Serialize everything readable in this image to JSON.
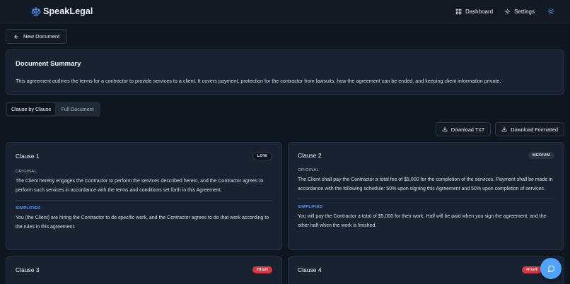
{
  "brand": {
    "name": "SpeakLegal"
  },
  "nav": {
    "dashboard": "Dashboard",
    "settings": "Settings"
  },
  "new_document": "New Document",
  "summary": {
    "title": "Document Summary",
    "text": "This agreement outlines the terms for a contractor to provide services to a client. It covers payment, protection for the contractor from lawsuits, how the agreement can be ended, and keeping client information private."
  },
  "view_toggle": {
    "clause_by_clause": "Clause by Clause",
    "full_document": "Full Document",
    "selected": "Clause by Clause"
  },
  "downloads": {
    "txt": "Download TXT",
    "formatted": "Download Formatted"
  },
  "labels": {
    "original": "ORIGINAL",
    "simplified": "SIMPLIFIED"
  },
  "clauses": [
    {
      "title": "Clause 1",
      "risk": "LOW",
      "original": "The Client hereby engages the Contractor to perform the services described herein, and the Contractor agrees to perform such services in accordance with the terms and conditions set forth in this Agreement.",
      "simplified": "You (the Client) are hiring the Contractor to do specific work, and the Contractor agrees to do that work according to the rules in this agreement."
    },
    {
      "title": "Clause 2",
      "risk": "MEDIUM",
      "original": "The Client shall pay the Contractor a total fee of $5,000 for the completion of the services. Payment shall be made in accordance with the following schedule: 50% upon signing this Agreement and 50% upon completion of services.",
      "simplified": "You will pay the Contractor a total of $5,000 for their work. Half will be paid when you sign the agreement, and the other half when the work is finished."
    },
    {
      "title": "Clause 3",
      "risk": "HIGH"
    },
    {
      "title": "Clause 4",
      "risk": "HIGH"
    }
  ],
  "colors": {
    "accent": "#4ea3ff",
    "high": "#d9363e",
    "background": "#0f1620",
    "card": "#182230"
  },
  "icons": [
    "scales-icon",
    "dashboard-grid-icon",
    "gear-icon",
    "sun-icon",
    "arrow-left-icon",
    "download-icon",
    "chat-icon"
  ]
}
